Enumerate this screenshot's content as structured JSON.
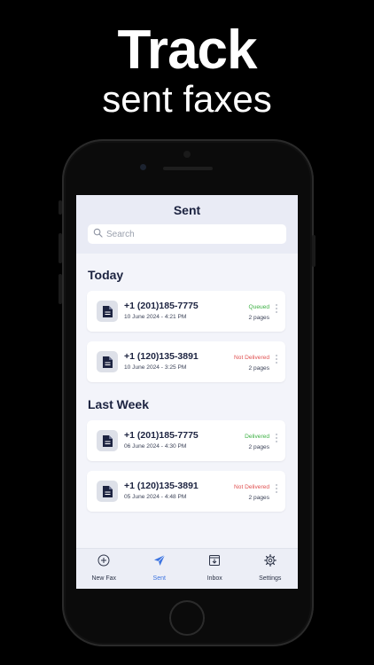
{
  "headline": {
    "line1": "Track",
    "line2": "sent faxes"
  },
  "screen": {
    "title": "Sent",
    "search": {
      "placeholder": "Search",
      "value": ""
    },
    "sections": [
      {
        "title": "Today",
        "items": [
          {
            "number": "+1 (201)185-7775",
            "date": "10 June 2024 - 4:21 PM",
            "status": "Queued",
            "status_color": "#3cb043",
            "pages": "2 pages"
          },
          {
            "number": "+1 (120)135-3891",
            "date": "10 June 2024 - 3:25 PM",
            "status": "Not Delivered",
            "status_color": "#e05050",
            "pages": "2 pages"
          }
        ]
      },
      {
        "title": "Last Week",
        "items": [
          {
            "number": "+1 (201)185-7775",
            "date": "06 June 2024 - 4:30 PM",
            "status": "Delivered",
            "status_color": "#3cb043",
            "pages": "2 pages"
          },
          {
            "number": "+1 (120)135-3891",
            "date": "05 June 2024 - 4:48 PM",
            "status": "Not Delivered",
            "status_color": "#e05050",
            "pages": "2 pages"
          }
        ]
      }
    ],
    "tabs": [
      {
        "label": "New Fax",
        "icon": "plus-circle-icon",
        "active": false
      },
      {
        "label": "Sent",
        "icon": "paper-plane-icon",
        "active": true
      },
      {
        "label": "Inbox",
        "icon": "inbox-tray-icon",
        "active": false
      },
      {
        "label": "Settings",
        "icon": "gear-icon",
        "active": false
      }
    ]
  },
  "colors": {
    "accent": "#3d74e0",
    "text_dark": "#1c2340",
    "screen_bg": "#f3f4fa",
    "delivered": "#3cb043",
    "not_delivered": "#e05050"
  }
}
